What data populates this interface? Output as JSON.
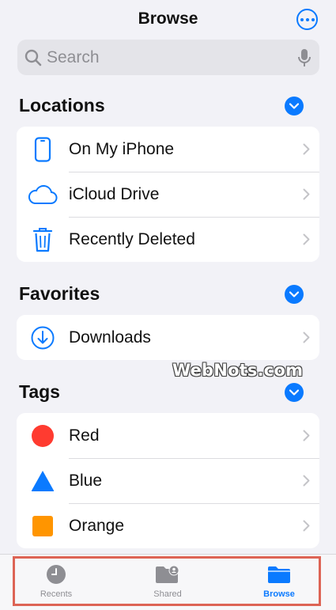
{
  "header": {
    "title": "Browse"
  },
  "search": {
    "placeholder": "Search"
  },
  "sections": {
    "locations": {
      "title": "Locations",
      "items": [
        {
          "label": "On My iPhone",
          "icon": "iphone-icon"
        },
        {
          "label": "iCloud Drive",
          "icon": "cloud-icon"
        },
        {
          "label": "Recently Deleted",
          "icon": "trash-icon"
        }
      ]
    },
    "favorites": {
      "title": "Favorites",
      "items": [
        {
          "label": "Downloads",
          "icon": "download-icon"
        }
      ]
    },
    "tags": {
      "title": "Tags",
      "items": [
        {
          "label": "Red",
          "color": "#ff3b30"
        },
        {
          "label": "Blue",
          "color": "#0a7aff"
        },
        {
          "label": "Orange",
          "color": "#ff9500"
        }
      ]
    }
  },
  "watermark": "WebNots.com",
  "tabbar": {
    "tabs": [
      {
        "label": "Recents",
        "icon": "clock-icon"
      },
      {
        "label": "Shared",
        "icon": "shared-folder-icon"
      },
      {
        "label": "Browse",
        "icon": "folder-icon",
        "active": true
      }
    ]
  },
  "colors": {
    "accent": "#0a7aff",
    "background": "#f2f2f7",
    "highlight": "#dd6455"
  }
}
